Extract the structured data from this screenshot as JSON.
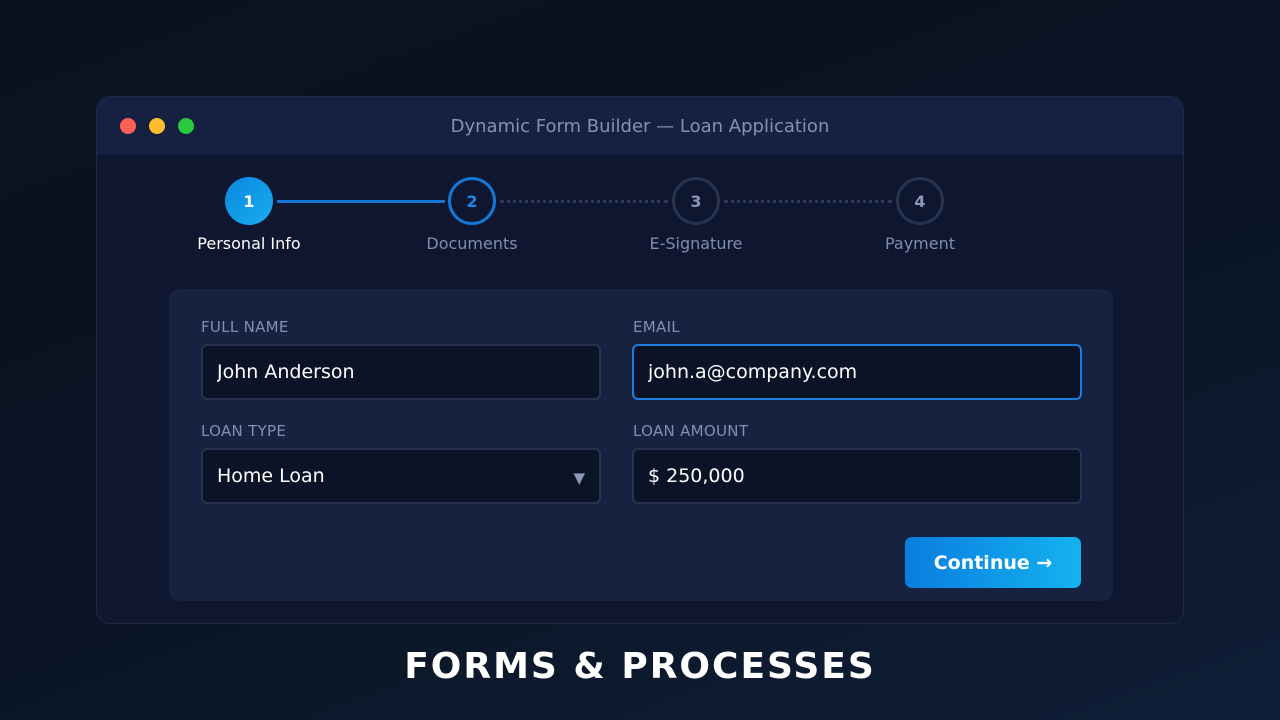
{
  "window": {
    "title": "Dynamic Form Builder — Loan Application"
  },
  "stepper": {
    "steps": [
      {
        "number": "1",
        "label": "Personal Info",
        "state": "completed"
      },
      {
        "number": "2",
        "label": "Documents",
        "state": "current"
      },
      {
        "number": "3",
        "label": "E-Signature",
        "state": "upcoming"
      },
      {
        "number": "4",
        "label": "Payment",
        "state": "upcoming"
      }
    ]
  },
  "form": {
    "full_name": {
      "label": "FULL NAME",
      "value": "John Anderson"
    },
    "email": {
      "label": "EMAIL",
      "value": "john.a@company.com"
    },
    "loan_type": {
      "label": "LOAN TYPE",
      "value": "Home Loan"
    },
    "loan_amount": {
      "label": "LOAN AMOUNT",
      "value": "$ 250,000"
    },
    "continue_label": "Continue →"
  },
  "caption": "FORMS & PROCESSES",
  "colors": {
    "accent": "#1477d6",
    "button_gradient_start": "#0a7de0",
    "button_gradient_end": "#14b3ef",
    "traffic_red": "#fe5f57",
    "traffic_yellow": "#febc2e",
    "traffic_green": "#28c840"
  },
  "icons": {
    "select_caret": "chevron-down-icon"
  }
}
